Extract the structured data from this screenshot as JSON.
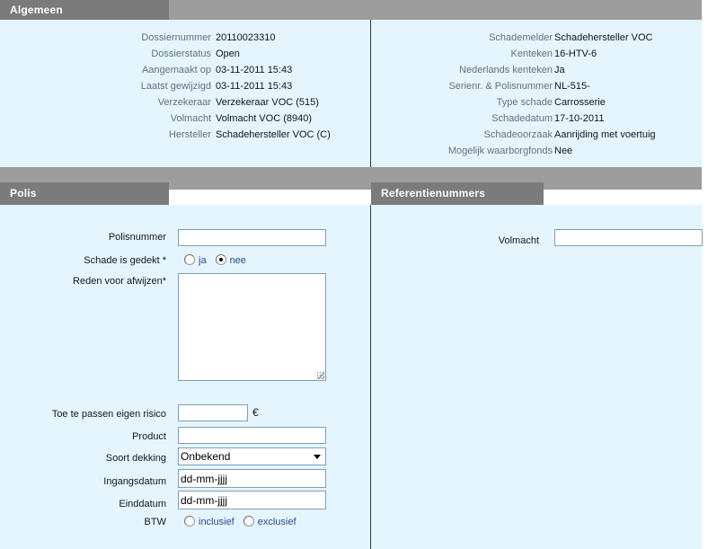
{
  "sections": {
    "algemeen": {
      "title": "Algemeen"
    },
    "polis": {
      "title": "Polis"
    },
    "referentienummers": {
      "title": "Referentienummers"
    }
  },
  "algemeen_left": [
    {
      "label": "Dossiernummer",
      "value": "20110023310"
    },
    {
      "label": "Dossierstatus",
      "value": "Open"
    },
    {
      "label": "Aangemaakt op",
      "value": "03-11-2011 15:43"
    },
    {
      "label": "Laatst gewijzigd",
      "value": "03-11-2011 15:43"
    },
    {
      "label": "Verzekeraar",
      "value": "Verzekeraar VOC (515)"
    },
    {
      "label": "Volmacht",
      "value": "Volmacht VOC (8940)"
    },
    {
      "label": "Hersteller",
      "value": "Schadehersteller VOC (C)"
    }
  ],
  "algemeen_right": [
    {
      "label": "Schademelder",
      "value": "Schadehersteller VOC"
    },
    {
      "label": "Kenteken",
      "value": "16-HTV-6"
    },
    {
      "label": "Nederlands kenteken",
      "value": "Ja"
    },
    {
      "label": "Serienr. & Polisnummer",
      "value": "NL-515-"
    },
    {
      "label": "Type schade",
      "value": "Carrosserie"
    },
    {
      "label": "Schadedatum",
      "value": "17-10-2011"
    },
    {
      "label": "Schadeoorzaak",
      "value": "Aanrijding met voertuig"
    },
    {
      "label": "Mogelijk waarborgfonds",
      "value": "Nee"
    }
  ],
  "polis_form": {
    "polisnummer": {
      "label": "Polisnummer",
      "value": ""
    },
    "schade_gedekt": {
      "label": "Schade is gedekt *",
      "options": [
        {
          "label": "ja",
          "checked": false
        },
        {
          "label": "nee",
          "checked": true
        }
      ]
    },
    "reden_afwijzen": {
      "label": "Reden voor afwijzen*",
      "value": ""
    },
    "eigen_risico": {
      "label": "Toe te passen eigen risico",
      "value": "",
      "suffix": "€"
    },
    "product": {
      "label": "Product",
      "value": ""
    },
    "soort_dekking": {
      "label": "Soort dekking",
      "value": "Onbekend",
      "options": [
        "Onbekend"
      ]
    },
    "ingangsdatum": {
      "label": "Ingangsdatum",
      "value": "dd-mm-jjjj"
    },
    "einddatum": {
      "label": "Einddatum",
      "value": "dd-mm-jjjj"
    },
    "btw": {
      "label": "BTW",
      "options": [
        {
          "label": "inclusief",
          "checked": false
        },
        {
          "label": "exclusief",
          "checked": false
        }
      ]
    }
  },
  "referentienummers_form": {
    "volmacht": {
      "label": "Volmacht",
      "value": ""
    }
  },
  "colors": {
    "panel_bg": "#e5f5fd",
    "band": "#9d9d9d",
    "tab": "#7b7b7b",
    "label": "#5f7184",
    "value": "#10161c",
    "link": "#2a4b8d",
    "input_border": "#7f9db9",
    "divider": "#2c3b4a"
  }
}
